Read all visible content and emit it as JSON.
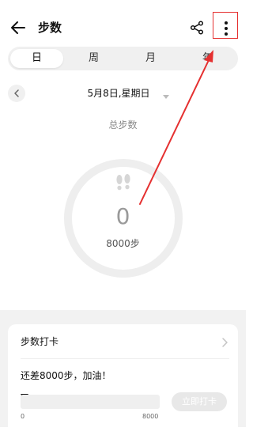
{
  "header": {
    "title": "步数",
    "back_icon": "arrow-left-icon",
    "share_icon": "share-icon",
    "more_icon": "more-vertical-icon"
  },
  "tabs": [
    {
      "label": "日",
      "active": true
    },
    {
      "label": "周",
      "active": false
    },
    {
      "label": "月",
      "active": false
    },
    {
      "label": "年",
      "active": false
    }
  ],
  "date": {
    "label": "5月8日,星期日",
    "prev_icon": "chevron-left-icon",
    "dropdown_icon": "caret-down-icon"
  },
  "summary": {
    "title": "总步数",
    "steps": "0",
    "goal": "8000步",
    "icon": "footprints-icon"
  },
  "checkin_card": {
    "title": "步数打卡",
    "hint": "还差8000步，加油！",
    "progress_min": "0",
    "progress_max": "8000",
    "progress_fraction": 0,
    "button_label": "立即打卡",
    "chevron_icon": "chevron-right-icon"
  },
  "colors": {
    "accent": "#1f7aff",
    "annotation": "#e53030",
    "ring": "#eeeeee",
    "muted_text": "#9a9a9a"
  }
}
